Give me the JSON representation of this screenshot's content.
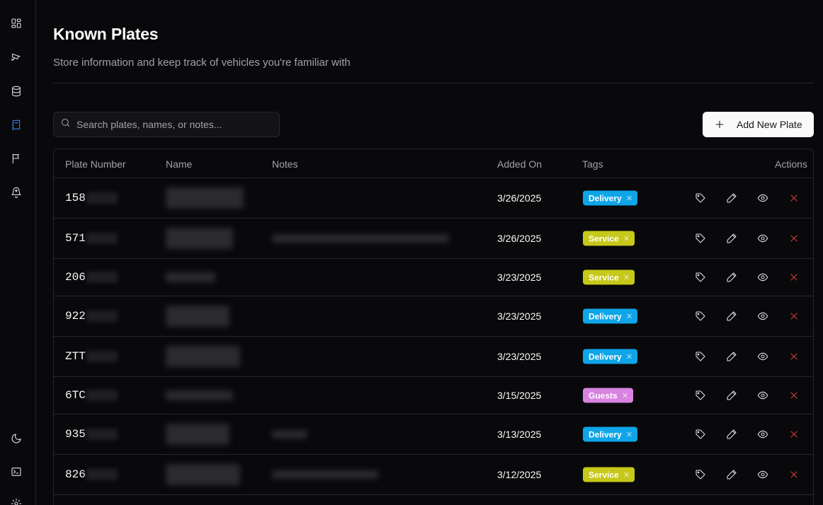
{
  "sidebar": {
    "items": [
      {
        "icon": "dashboard-grid-icon"
      },
      {
        "icon": "camera-icon"
      },
      {
        "icon": "database-icon"
      },
      {
        "icon": "book-icon",
        "active": true
      },
      {
        "icon": "flag-icon"
      },
      {
        "icon": "bell-plus-icon"
      },
      {
        "icon": "moon-icon"
      },
      {
        "icon": "terminal-icon"
      },
      {
        "icon": "settings-icon"
      }
    ]
  },
  "header": {
    "title": "Known Plates",
    "subtitle": "Store information and keep track of vehicles you're familiar with"
  },
  "search": {
    "placeholder": "Search plates, names, or notes..."
  },
  "add_button": {
    "label": "Add New Plate"
  },
  "table": {
    "columns": {
      "plate": "Plate Number",
      "name": "Name",
      "notes": "Notes",
      "added": "Added On",
      "tags": "Tags",
      "actions": "Actions"
    },
    "rows": [
      {
        "plate": "158",
        "added": "3/26/2025",
        "tag": "Delivery",
        "tag_color": "#0ea5e9"
      },
      {
        "plate": "571",
        "added": "3/26/2025",
        "tag": "Service",
        "tag_color": "#c6c81a"
      },
      {
        "plate": "206",
        "added": "3/23/2025",
        "tag": "Service",
        "tag_color": "#c6c81a"
      },
      {
        "plate": "922",
        "added": "3/23/2025",
        "tag": "Delivery",
        "tag_color": "#0ea5e9"
      },
      {
        "plate": "ZTT",
        "added": "3/23/2025",
        "tag": "Delivery",
        "tag_color": "#0ea5e9"
      },
      {
        "plate": "6TC",
        "added": "3/15/2025",
        "tag": "Guests",
        "tag_color": "#d883e0"
      },
      {
        "plate": "935",
        "added": "3/13/2025",
        "tag": "Delivery",
        "tag_color": "#0ea5e9"
      },
      {
        "plate": "826",
        "added": "3/12/2025",
        "tag": "Service",
        "tag_color": "#c6c81a"
      }
    ]
  },
  "colors": {
    "accent": "#3b82f6",
    "delete": "#ef4444",
    "background": "#09090b",
    "border": "#27272a"
  }
}
